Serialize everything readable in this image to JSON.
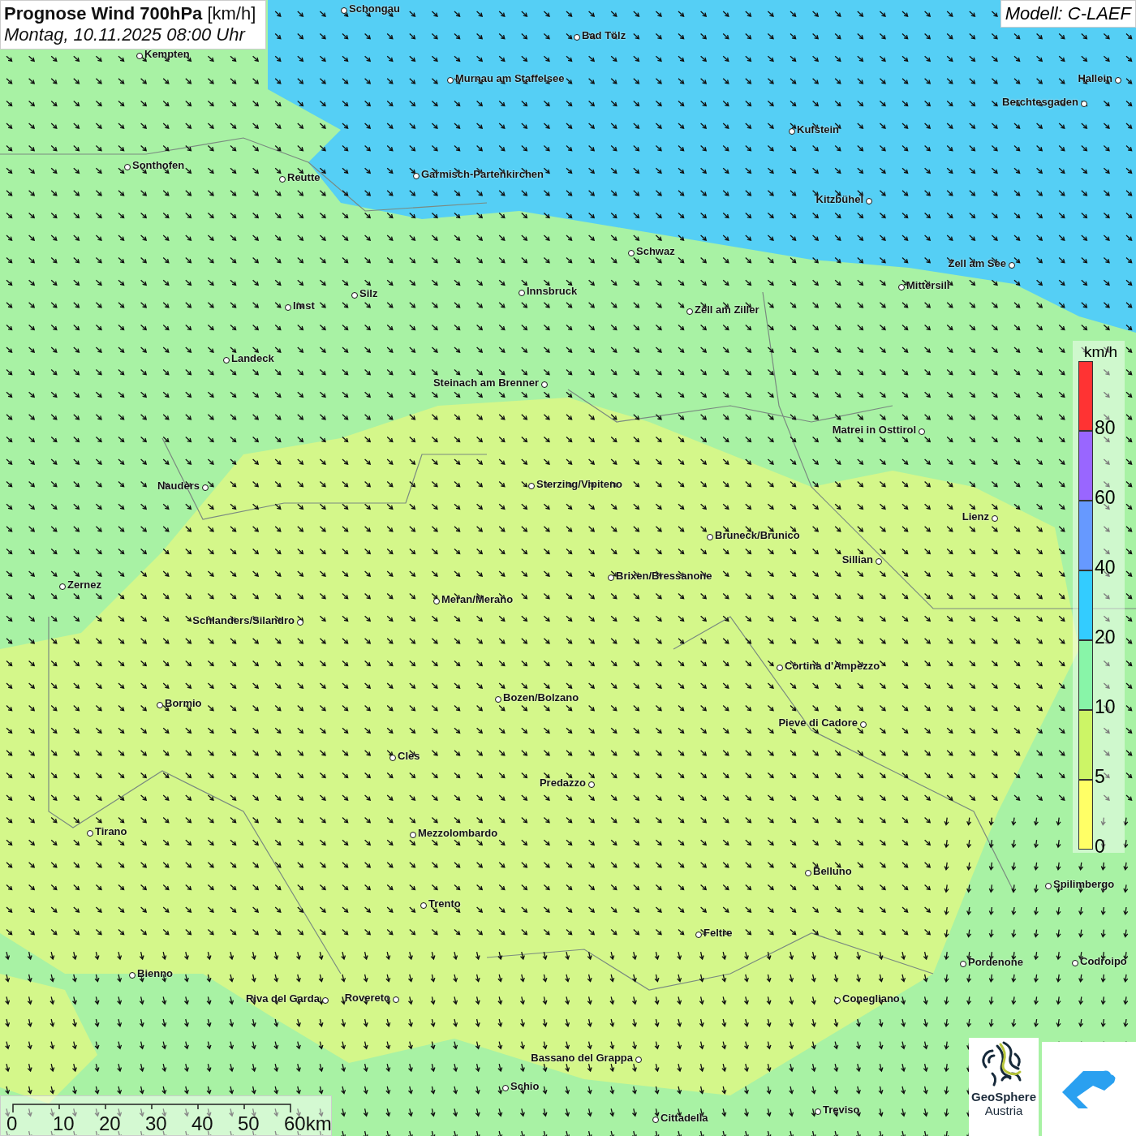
{
  "header": {
    "title": "**Prognose Wind 700hPa** [km/h]",
    "subtitle": "Montag, 10.11.2025 08:00 Uhr"
  },
  "model": "Modell: C-LAEF",
  "cities": [
    {
      "name": "Schongau"
    },
    {
      "name": "Bad Tölz"
    },
    {
      "name": "Kempten"
    },
    {
      "name": "Murnau am Staffelsee"
    },
    {
      "name": "Hallein"
    },
    {
      "name": "Berchtesgaden"
    },
    {
      "name": "Kufstein"
    },
    {
      "name": "Sonthofen"
    },
    {
      "name": "Reutte"
    },
    {
      "name": "Garmisch-Partenkirchen"
    },
    {
      "name": "Kitzbühel"
    },
    {
      "name": "Schwaz"
    },
    {
      "name": "Zell am See"
    },
    {
      "name": "Mittersill"
    },
    {
      "name": "Silz"
    },
    {
      "name": "Innsbruck"
    },
    {
      "name": "Imst"
    },
    {
      "name": "Zell am Ziller"
    },
    {
      "name": "Landeck"
    },
    {
      "name": "Steinach am Brenner"
    },
    {
      "name": "Matrei in Osttirol"
    },
    {
      "name": "Nauders"
    },
    {
      "name": "Sterzing/Vipiteno"
    },
    {
      "name": "Lienz"
    },
    {
      "name": "Bruneck/Brunico"
    },
    {
      "name": "Sillian"
    },
    {
      "name": "Brixen/Bressanone"
    },
    {
      "name": "Zernez"
    },
    {
      "name": "Meran/Merano"
    },
    {
      "name": "Schlanders/Silandro"
    },
    {
      "name": "Cortina d'Ampezzo"
    },
    {
      "name": "Bozen/Bolzano"
    },
    {
      "name": "Bormio"
    },
    {
      "name": "Pieve di Cadore"
    },
    {
      "name": "Cles"
    },
    {
      "name": "Predazzo"
    },
    {
      "name": "Tirano"
    },
    {
      "name": "Mezzolombardo"
    },
    {
      "name": "Belluno"
    },
    {
      "name": "Spilimbergo"
    },
    {
      "name": "Trento"
    },
    {
      "name": "Feltre"
    },
    {
      "name": "Pordenone"
    },
    {
      "name": "Codroipo"
    },
    {
      "name": "Bienno"
    },
    {
      "name": "Riva del Garda"
    },
    {
      "name": "Rovereto"
    },
    {
      "name": "Conegliano"
    },
    {
      "name": "Bassano del Grappa"
    },
    {
      "name": "Schio"
    },
    {
      "name": "Treviso"
    },
    {
      "name": "Cittadella"
    }
  ],
  "legend": {
    "unit": "km/h",
    "bins": [
      {
        "label": "80",
        "color": "#ff3333"
      },
      {
        "label": "60",
        "color": "#9966ff"
      },
      {
        "label": "40",
        "color": "#6699ff"
      },
      {
        "label": "20",
        "color": "#33ccff"
      },
      {
        "label": "10",
        "color": "#88f5a8"
      },
      {
        "label": "5",
        "color": "#ccf566"
      },
      {
        "label": "0",
        "color": "#ffff66"
      }
    ]
  },
  "scale_bar": {
    "ticks": [
      "0",
      "10",
      "20",
      "30",
      "40",
      "50",
      "60km"
    ]
  },
  "logos": {
    "name": "GeoSphere",
    "country": "Austria"
  }
}
